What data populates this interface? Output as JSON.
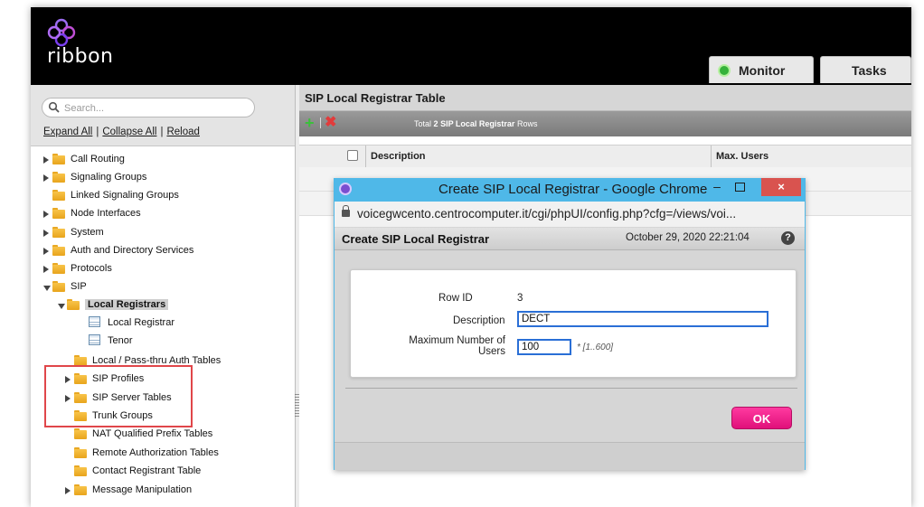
{
  "header": {
    "logo_text": "ribbon",
    "tabs": [
      {
        "label": "Monitor",
        "icon": "status-dot-green"
      },
      {
        "label": "Tasks"
      }
    ]
  },
  "sidebar": {
    "search_placeholder": "Search...",
    "links": {
      "expand_all": "Expand All",
      "collapse_all": "Collapse All",
      "reload": "Reload",
      "separator": "|"
    },
    "tree": [
      {
        "label": "Call Routing",
        "expander": "collapsed",
        "icon": "folder-icon"
      },
      {
        "label": "Signaling Groups",
        "expander": "collapsed",
        "icon": "folder-icon"
      },
      {
        "label": "Linked Signaling Groups",
        "expander": "none",
        "icon": "folder-icon"
      },
      {
        "label": "Node Interfaces",
        "expander": "collapsed",
        "icon": "folder-icon"
      },
      {
        "label": "System",
        "expander": "collapsed",
        "icon": "folder-icon"
      },
      {
        "label": "Auth and Directory Services",
        "expander": "collapsed",
        "icon": "folder-icon"
      },
      {
        "label": "Protocols",
        "expander": "collapsed",
        "icon": "folder-icon"
      },
      {
        "label": "SIP",
        "expander": "expanded",
        "icon": "folder-open-icon"
      },
      {
        "label": "Local Registrars",
        "expander": "expanded",
        "icon": "folder-open-icon",
        "selected": true
      },
      {
        "label": "Local Registrar",
        "icon": "table-icon"
      },
      {
        "label": "Tenor",
        "icon": "table-icon"
      },
      {
        "label": "Local / Pass-thru Auth Tables",
        "expander": "none",
        "icon": "folder-icon"
      },
      {
        "label": "SIP Profiles",
        "expander": "collapsed",
        "icon": "folder-icon"
      },
      {
        "label": "SIP Server Tables",
        "expander": "collapsed",
        "icon": "folder-icon"
      },
      {
        "label": "Trunk Groups",
        "expander": "none",
        "icon": "folder-icon"
      },
      {
        "label": "NAT Qualified Prefix Tables",
        "expander": "none",
        "icon": "folder-icon"
      },
      {
        "label": "Remote Authorization Tables",
        "expander": "none",
        "icon": "folder-icon"
      },
      {
        "label": "Contact Registrant Table",
        "expander": "none",
        "icon": "folder-icon"
      },
      {
        "label": "Message Manipulation",
        "expander": "collapsed",
        "icon": "folder-icon"
      }
    ]
  },
  "main": {
    "title": "SIP Local Registrar Table",
    "toolbar": {
      "add_icon": "plus-icon",
      "delete_icon": "x-icon",
      "total_prefix": "Total",
      "total_count": "2",
      "total_entity": "SIP Local Registrar",
      "total_suffix": "Rows"
    },
    "columns": [
      "Description",
      "Max. Users"
    ]
  },
  "popup": {
    "window_title": "Create SIP Local Registrar - Google Chrome",
    "url": "voicegwcento.centrocomputer.it/cgi/phpUI/config.php?cfg=/views/voi...",
    "dialog_title": "Create SIP Local Registrar",
    "timestamp": "October 29, 2020 22:21:04",
    "help": "?",
    "form": {
      "row_id_label": "Row ID",
      "row_id_value": "3",
      "description_label": "Description",
      "description_value": "DECT",
      "max_users_label": "Maximum Number of Users",
      "max_users_value": "100",
      "max_users_hint": "* [1..600]"
    },
    "ok_label": "OK",
    "close_glyph": "×",
    "min_glyph": "–"
  },
  "colors": {
    "header_bg": "#000000",
    "popup_frame": "#4fb8e8",
    "ok_button": "#ff3aa0",
    "highlight": "#e0464a",
    "add_green": "#3bbf3b",
    "delete_red": "#e23b3b"
  }
}
